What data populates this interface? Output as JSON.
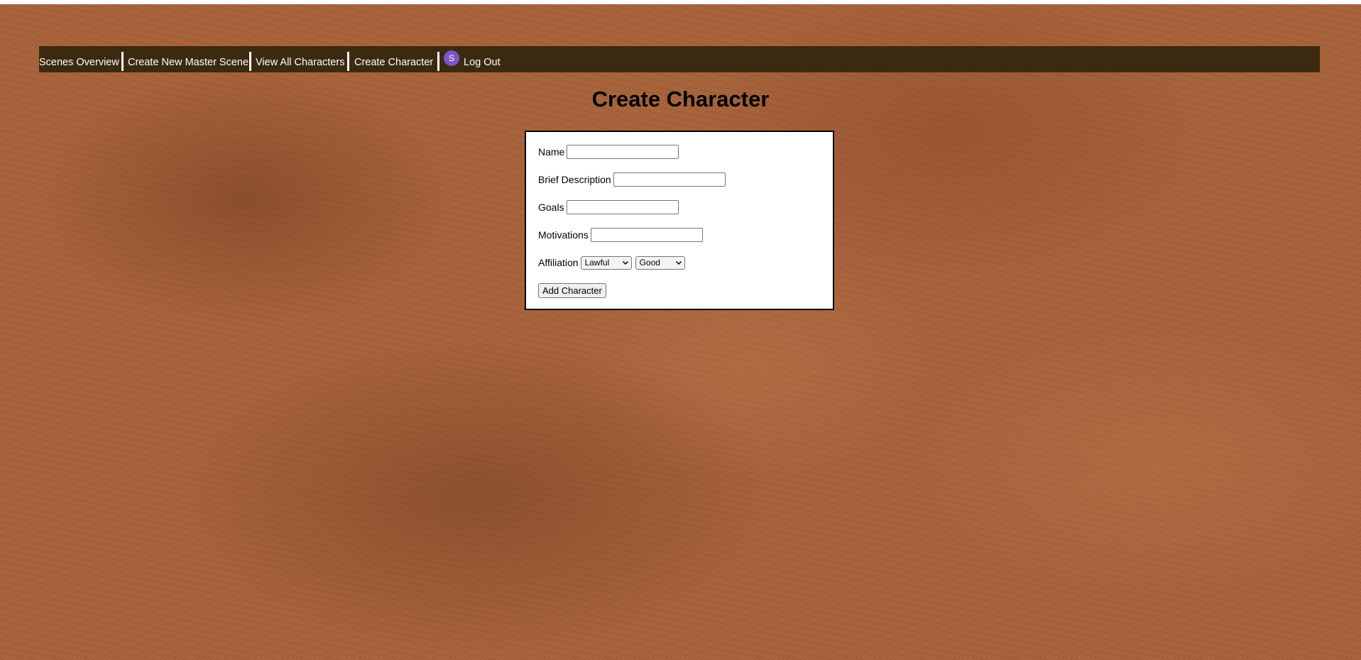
{
  "nav": {
    "items": [
      {
        "label": "Scenes Overview"
      },
      {
        "label": "Create New Master Scene"
      },
      {
        "label": "View All Characters"
      },
      {
        "label": "Create Character"
      }
    ],
    "avatar_initial": "S",
    "logout_label": "Log Out"
  },
  "page": {
    "title": "Create Character"
  },
  "form": {
    "fields": {
      "name_label": "Name",
      "name_value": "",
      "description_label": "Brief Description",
      "description_value": "",
      "goals_label": "Goals",
      "goals_value": "",
      "motivations_label": "Motivations",
      "motivations_value": ""
    },
    "affiliation": {
      "label": "Affiliation",
      "law_selected": "Lawful",
      "moral_selected": "Good"
    },
    "submit_label": "Add Character"
  },
  "colors": {
    "navbar_bg": "#3c2a10",
    "background": "#a9643c",
    "avatar_bg": "#7a55c8"
  }
}
